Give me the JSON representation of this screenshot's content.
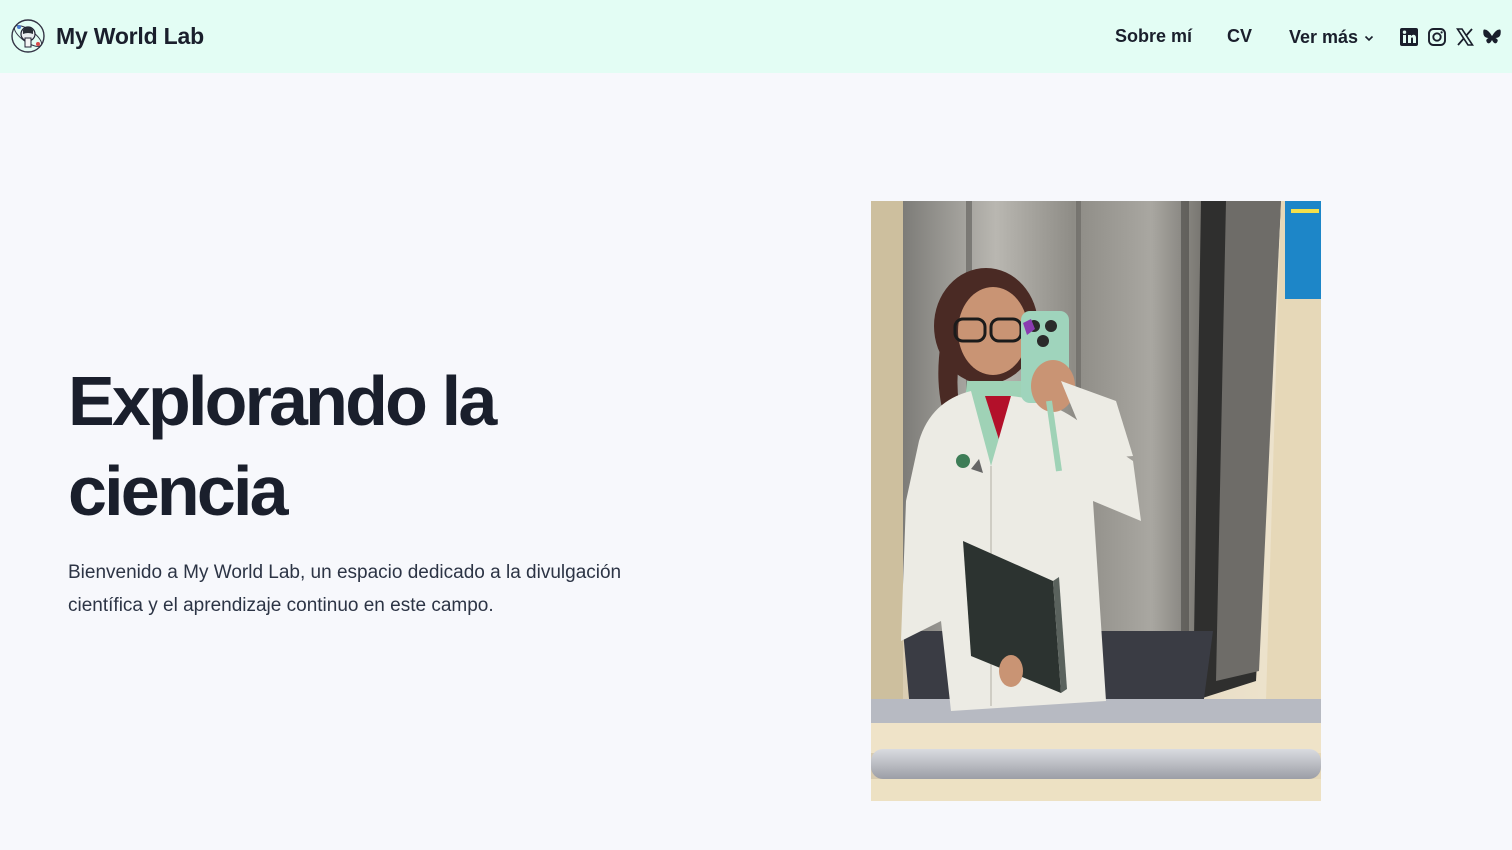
{
  "header": {
    "site_name": "My World Lab",
    "logo": "lab-globe-logo",
    "nav": {
      "about_label": "Sobre mí",
      "cv_label": "CV",
      "more_label": "Ver más"
    },
    "social": [
      {
        "name": "linkedin-icon"
      },
      {
        "name": "instagram-icon"
      },
      {
        "name": "x-icon"
      },
      {
        "name": "bluesky-icon"
      }
    ],
    "colors": {
      "header_bg": "#e3fdf4",
      "text": "#1a1f2c"
    }
  },
  "hero": {
    "title_line1": "Explorando la",
    "title_line2": "ciencia",
    "description": "Bienvenido a My World Lab, un espacio dedicado a la divulgación científica y el aprendizaje continuo en este campo.",
    "photo": "elevator-mirror-selfie-lab-coat"
  }
}
